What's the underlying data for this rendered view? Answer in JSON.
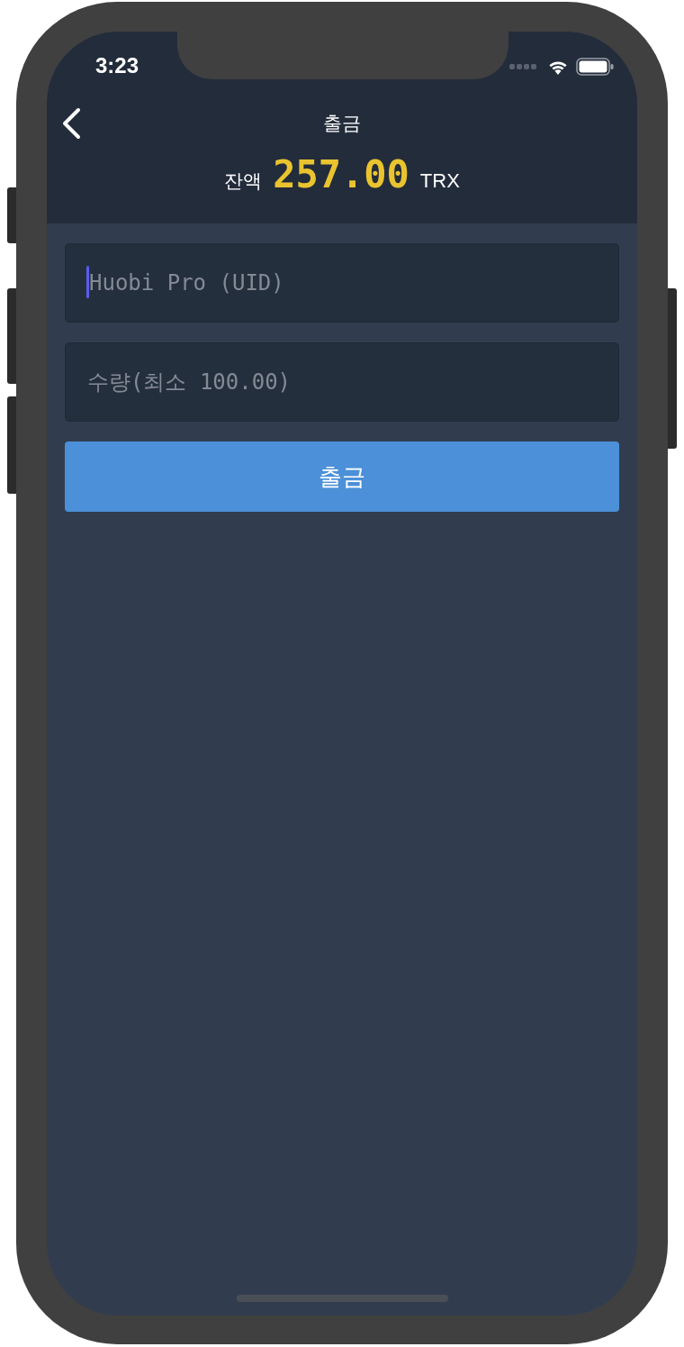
{
  "status_bar": {
    "time": "3:23"
  },
  "header": {
    "title": "출금",
    "balance_label": "잔액",
    "balance": "257.00",
    "currency": "TRX"
  },
  "fields": [
    {
      "placeholder": "Huobi Pro (UID)",
      "focused": true
    },
    {
      "placeholder": "수량(최소 100.00)",
      "focused": false
    }
  ],
  "submit_button": "출금"
}
